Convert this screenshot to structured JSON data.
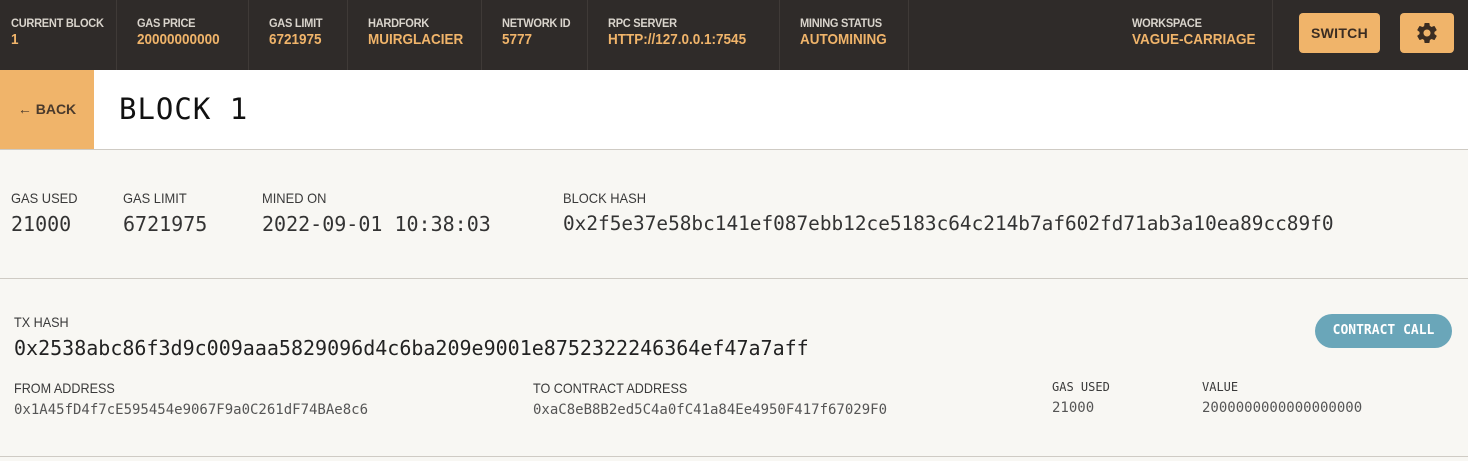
{
  "topbar": {
    "stats": [
      {
        "label": "CURRENT BLOCK",
        "value": "1"
      },
      {
        "label": "GAS PRICE",
        "value": "20000000000"
      },
      {
        "label": "GAS LIMIT",
        "value": "6721975"
      },
      {
        "label": "HARDFORK",
        "value": "MUIRGLACIER"
      },
      {
        "label": "NETWORK ID",
        "value": "5777"
      },
      {
        "label": "RPC SERVER",
        "value": "HTTP://127.0.0.1:7545"
      },
      {
        "label": "MINING STATUS",
        "value": "AUTOMINING"
      }
    ],
    "workspace": {
      "label": "WORKSPACE",
      "value": "VAGUE-CARRIAGE"
    },
    "switch_label": "SWITCH",
    "settings_icon": "gear-icon"
  },
  "header": {
    "back_label": "← BACK",
    "title": "BLOCK 1"
  },
  "block_info": {
    "gas_used": {
      "label": "GAS USED",
      "value": "21000"
    },
    "gas_limit": {
      "label": "GAS LIMIT",
      "value": "6721975"
    },
    "mined_on": {
      "label": "MINED ON",
      "value": "2022-09-01 10:38:03"
    },
    "block_hash": {
      "label": "BLOCK HASH",
      "value": "0x2f5e37e58bc141ef087ebb12ce5183c64c214b7af602fd71ab3a10ea89cc89f0"
    }
  },
  "transaction": {
    "tx_hash_label": "TX HASH",
    "tx_hash": "0x2538abc86f3d9c009aaa5829096d4c6ba209e9001e8752322246364ef47a7aff",
    "type_badge": "CONTRACT CALL",
    "from_label": "FROM ADDRESS",
    "from": "0x1A45fD4f7cE595454e9067F9a0C261dF74BAe8c6",
    "to_label": "TO CONTRACT ADDRESS",
    "to": "0xaC8eB8B2ed5C4a0fC41a84Ee4950F417f67029F0",
    "gas_used_label": "GAS USED",
    "gas_used": "21000",
    "value_label": "VALUE",
    "value": "2000000000000000000"
  },
  "colors": {
    "topbar_bg": "#2f2b29",
    "accent": "#f0b46a",
    "badge": "#6aa6b9",
    "page_bg": "#f8f7f3"
  }
}
